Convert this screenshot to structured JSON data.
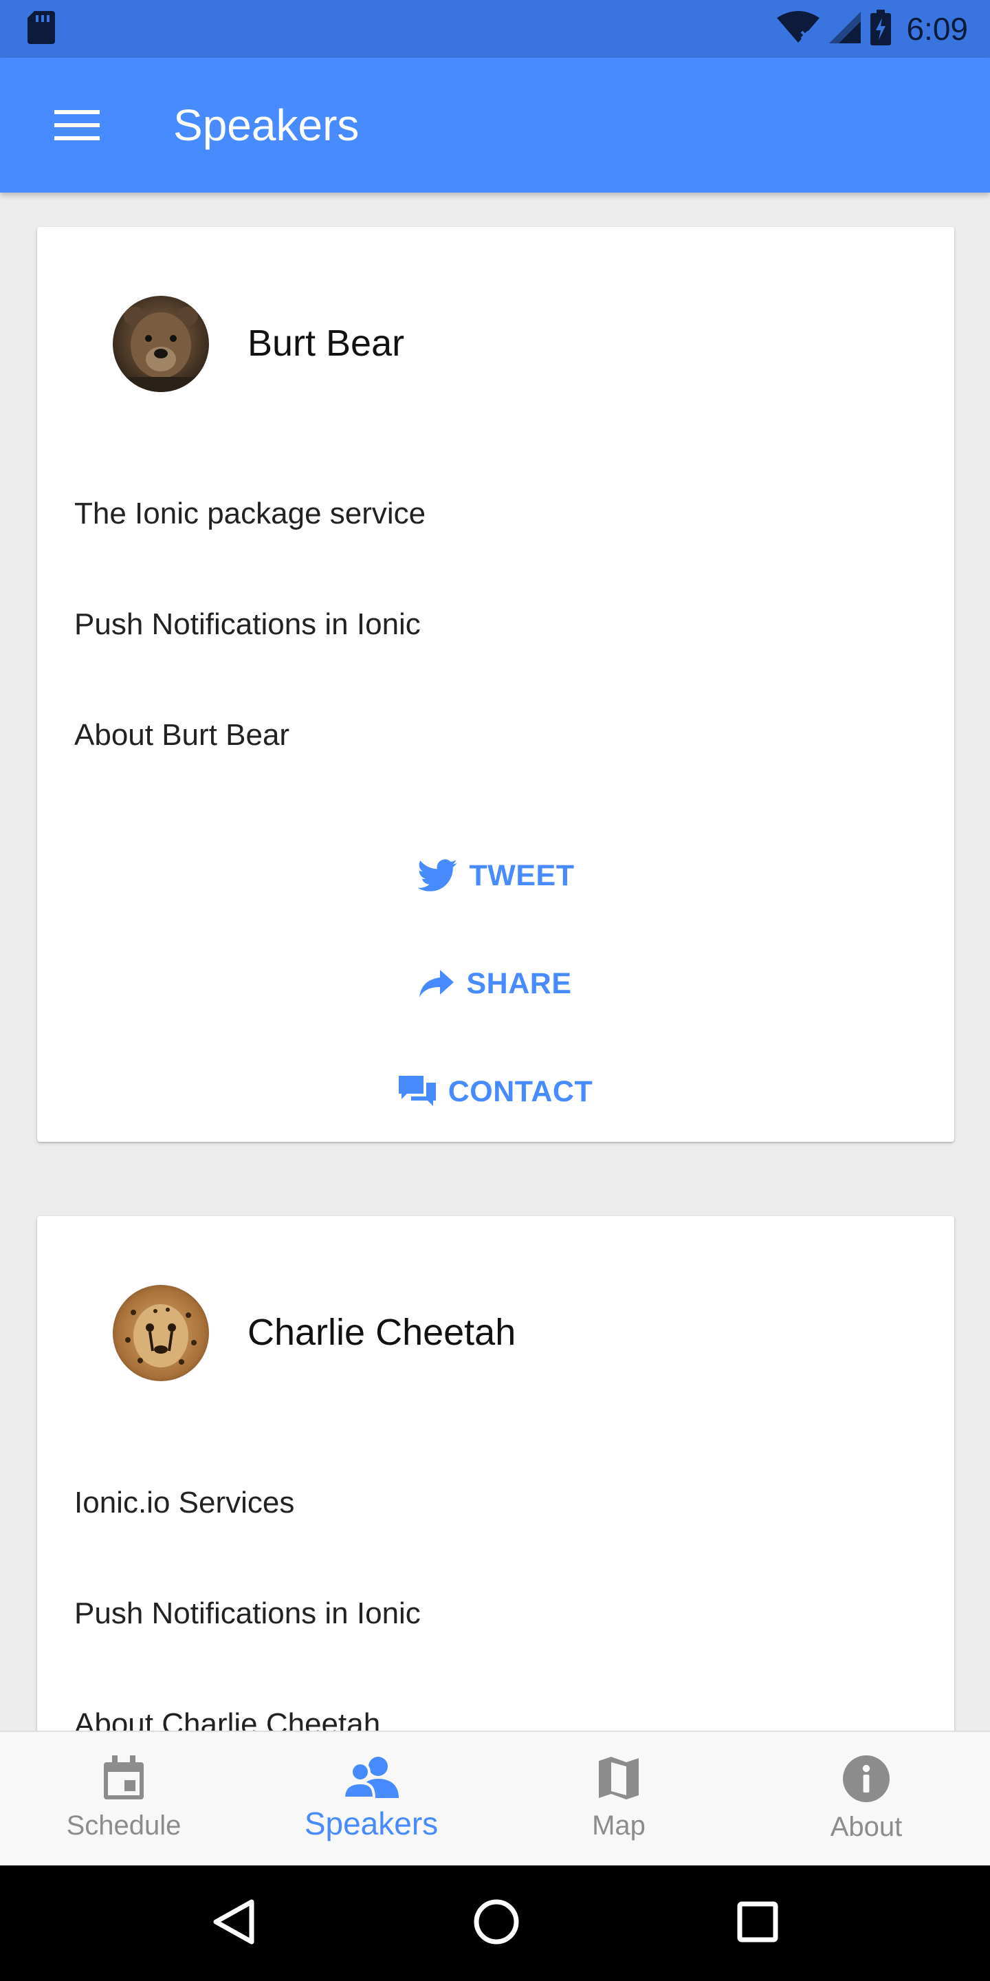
{
  "status_bar": {
    "time": "6:09"
  },
  "toolbar": {
    "title": "Speakers"
  },
  "speakers": [
    {
      "name": "Burt Bear",
      "avatar": "bear-photo",
      "items": [
        "The Ionic package service",
        "Push Notifications in Ionic",
        "About Burt Bear"
      ],
      "actions": {
        "tweet": "TWEET",
        "share": "SHARE",
        "contact": "CONTACT"
      }
    },
    {
      "name": "Charlie Cheetah",
      "avatar": "cheetah-photo",
      "items": [
        "Ionic.io Services",
        "Push Notifications in Ionic",
        "About Charlie Cheetah"
      ]
    }
  ],
  "tabs": [
    {
      "label": "Schedule",
      "icon": "calendar-icon",
      "selected": false
    },
    {
      "label": "Speakers",
      "icon": "people-icon",
      "selected": true
    },
    {
      "label": "Map",
      "icon": "map-icon",
      "selected": false
    },
    {
      "label": "About",
      "icon": "info-icon",
      "selected": false
    }
  ],
  "colors": {
    "primary": "#488aff",
    "status_bar": "#3a75df",
    "background": "#ececec",
    "tab_inactive": "#8c8c8c"
  }
}
